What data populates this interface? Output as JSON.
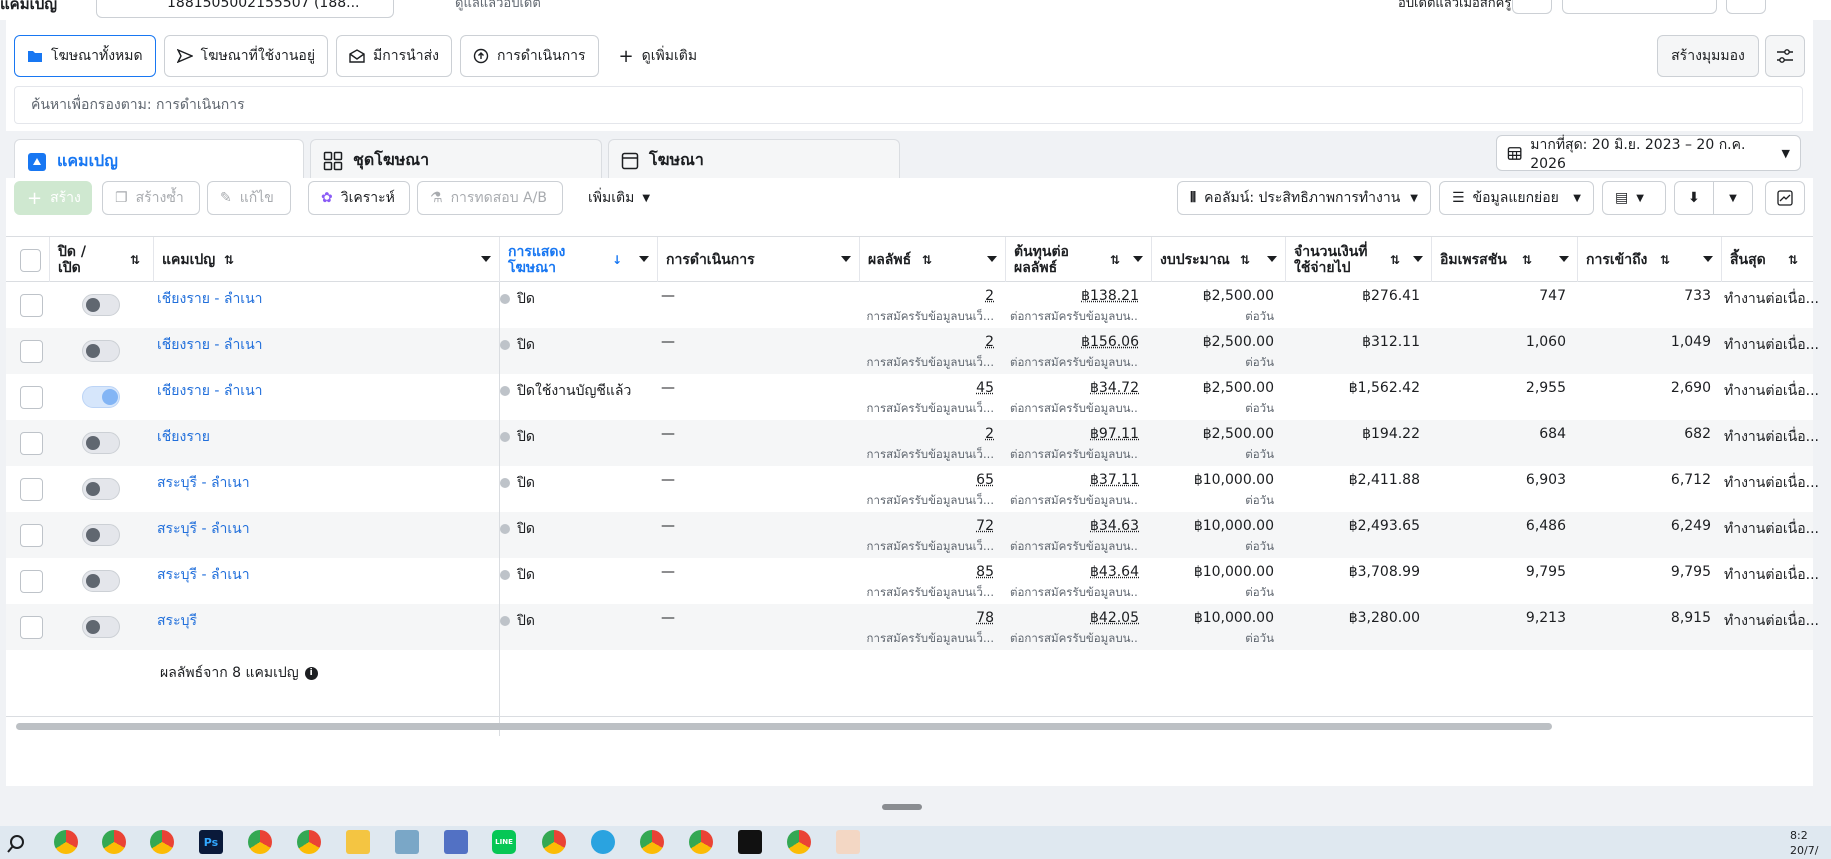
{
  "topbar": {
    "account_label": "แคมเปญ",
    "account_id": "1881505002155507 (188...",
    "updated": "ดูแลแล้วอัปเดต",
    "right_text": "อัปเดตแล้วเมื่อสักครู่"
  },
  "filters": [
    {
      "label": "โฆษณาทั้งหมด",
      "icon": "folder-icon",
      "active": true
    },
    {
      "label": "โฆษณาที่ใช้งานอยู่",
      "icon": "send-icon",
      "active": false
    },
    {
      "label": "มีการนำส่ง",
      "icon": "envelope-icon",
      "active": false
    },
    {
      "label": "การดำเนินการ",
      "icon": "arrow-up-circle-icon",
      "active": false
    },
    {
      "label": "ดูเพิ่มเติม",
      "icon": "plus-icon",
      "active": false
    }
  ],
  "create_view_label": "สร้างมุมมอง",
  "search": {
    "placeholder": "ค้นหาเพื่อกรองตาม: การดำเนินการ"
  },
  "tabs": [
    {
      "label": "แคมเปญ",
      "icon": "campaign-icon",
      "active": true
    },
    {
      "label": "ชุดโฆษณา",
      "icon": "grid-icon",
      "active": false
    },
    {
      "label": "โฆษณา",
      "icon": "ad-icon",
      "active": false
    }
  ],
  "date_range": "มากที่สุด: 20 มิ.ย. 2023 – 20 ก.ค. 2026",
  "toolbar": {
    "create": "สร้าง",
    "duplicate": "สร้างซ้ำ",
    "edit": "แก้ไข",
    "analyze": "วิเคราะห์",
    "ab_test": "การทดสอบ A/B",
    "more": "เพิ่มเติม",
    "columns": "คอลัมน์: ประสิทธิภาพการทำงาน",
    "breakdown": "ข้อมูลแยกย่อย"
  },
  "columns": {
    "onoff": "ปิด / เปิด",
    "campaign": "แคมเปญ",
    "delivery": "การแสดงโฆษณา",
    "actions": "การดำเนินการ",
    "results": "ผลลัพธ์",
    "cost_per_result": "ต้นทุนต่อผลลัพธ์",
    "budget": "งบประมาณ",
    "amount_spent": "จำนวนเงินที่ใช้จ่ายไป",
    "impressions": "อิมเพรสชัน",
    "reach": "การเข้าถึง",
    "ends": "สิ้นสุด"
  },
  "sub_labels": {
    "result": "การสมัครรับข้อมูลบนเว็...",
    "cost": "ต่อการสมัครรับข้อมูลบน...",
    "budget": "ต่อวัน"
  },
  "rows": [
    {
      "name": "เชียงราย - ลำเนา",
      "on": false,
      "delivery": "ปิด",
      "actions": "—",
      "results": "2",
      "cpr": "฿138.21",
      "budget": "฿2,500.00",
      "spent": "฿276.41",
      "impressions": "747",
      "reach": "733",
      "ends": "ทำงานต่อเนื่อ..."
    },
    {
      "name": "เชียงราย - ลำเนา",
      "on": false,
      "delivery": "ปิด",
      "actions": "—",
      "results": "2",
      "cpr": "฿156.06",
      "budget": "฿2,500.00",
      "spent": "฿312.11",
      "impressions": "1,060",
      "reach": "1,049",
      "ends": "ทำงานต่อเนื่อ..."
    },
    {
      "name": "เชียงราย - ลำเนา",
      "on": true,
      "delivery": "ปิดใช้งานบัญชีแล้ว",
      "actions": "—",
      "results": "45",
      "cpr": "฿34.72",
      "budget": "฿2,500.00",
      "spent": "฿1,562.42",
      "impressions": "2,955",
      "reach": "2,690",
      "ends": "ทำงานต่อเนื่อ..."
    },
    {
      "name": "เชียงราย",
      "on": false,
      "delivery": "ปิด",
      "actions": "—",
      "results": "2",
      "cpr": "฿97.11",
      "budget": "฿2,500.00",
      "spent": "฿194.22",
      "impressions": "684",
      "reach": "682",
      "ends": "ทำงานต่อเนื่อ..."
    },
    {
      "name": "สระบุรี - ลำเนา",
      "on": false,
      "delivery": "ปิด",
      "actions": "—",
      "results": "65",
      "cpr": "฿37.11",
      "budget": "฿10,000.00",
      "spent": "฿2,411.88",
      "impressions": "6,903",
      "reach": "6,712",
      "ends": "ทำงานต่อเนื่อ..."
    },
    {
      "name": "สระบุรี - ลำเนา",
      "on": false,
      "delivery": "ปิด",
      "actions": "—",
      "results": "72",
      "cpr": "฿34.63",
      "budget": "฿10,000.00",
      "spent": "฿2,493.65",
      "impressions": "6,486",
      "reach": "6,249",
      "ends": "ทำงานต่อเนื่อ..."
    },
    {
      "name": "สระบุรี - ลำเนา",
      "on": false,
      "delivery": "ปิด",
      "actions": "—",
      "results": "85",
      "cpr": "฿43.64",
      "budget": "฿10,000.00",
      "spent": "฿3,708.99",
      "impressions": "9,795",
      "reach": "9,795",
      "ends": "ทำงานต่อเนื่อ..."
    },
    {
      "name": "สระบุรี",
      "on": false,
      "delivery": "ปิด",
      "actions": "—",
      "results": "78",
      "cpr": "฿42.05",
      "budget": "฿10,000.00",
      "spent": "฿3,280.00",
      "impressions": "9,213",
      "reach": "8,915",
      "ends": "ทำงานต่อเนื่อ..."
    }
  ],
  "footer": {
    "summary": "ผลลัพธ์จาก 8 แคมเปญ"
  },
  "taskbar": {
    "time": "8:2",
    "date": "20/7/"
  },
  "colors": {
    "accent": "#1877f2",
    "link": "#216fdb",
    "create_button": "#cfe8d0"
  }
}
